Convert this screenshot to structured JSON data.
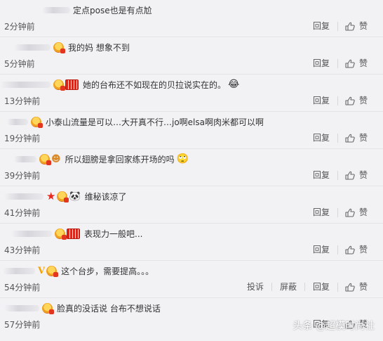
{
  "comments": [
    {
      "indent": 60,
      "blurWidth": 40,
      "badges": [],
      "text": "定点pose也是有点尬",
      "emoji": "",
      "time": "2分钟前",
      "actions": [
        "回复"
      ],
      "like": "赞"
    },
    {
      "indent": 20,
      "blurWidth": 52,
      "badges": [
        "badge"
      ],
      "text": "我的妈 想象不到",
      "emoji": "",
      "time": "5分钟前",
      "actions": [
        "回复"
      ],
      "like": "赞"
    },
    {
      "indent": 0,
      "blurWidth": 72,
      "badges": [
        "badge",
        "red"
      ],
      "text": "她的台布还不如现在的贝拉说实在的。",
      "emoji": "😂",
      "time": "13分钟前",
      "actions": [
        "回复"
      ],
      "like": "赞"
    },
    {
      "indent": 10,
      "blurWidth": 30,
      "badges": [
        "badge"
      ],
      "text": "小泰山流量是可以…大开真不行…jo啊elsa啊肉米都可以啊",
      "emoji": "",
      "time": "19分钟前",
      "actions": [
        "回复"
      ],
      "like": "赞"
    },
    {
      "indent": 20,
      "blurWidth": 32,
      "badges": [
        "badge",
        "cloud"
      ],
      "text": "所以翅膀是拿回家练开场的吗",
      "emoji": "🙄",
      "time": "39分钟前",
      "actions": [
        "回复"
      ],
      "like": "赞"
    },
    {
      "indent": 6,
      "blurWidth": 56,
      "badges": [
        "star",
        "badge",
        "panda"
      ],
      "text": "维秘该凉了",
      "emoji": "",
      "time": "41分钟前",
      "actions": [
        "回复"
      ],
      "like": "赞"
    },
    {
      "indent": 16,
      "blurWidth": 58,
      "badges": [
        "badge",
        "red"
      ],
      "text": "表现力一般吧...",
      "emoji": "",
      "time": "43分钟前",
      "actions": [
        "回复"
      ],
      "like": "赞"
    },
    {
      "indent": 4,
      "blurWidth": 46,
      "badges": [
        "vip",
        "badge"
      ],
      "text": "这个台步，需要提高。。。",
      "emoji": "",
      "time": "54分钟前",
      "actions": [
        "投诉",
        "屏蔽",
        "回复"
      ],
      "like": "赞"
    },
    {
      "indent": 6,
      "blurWidth": 50,
      "badges": [
        "badge"
      ],
      "text": "脸真的没话说 台布不想说话",
      "emoji": "",
      "time": "57分钟前",
      "actions": [
        "回复"
      ],
      "like": "赞"
    }
  ],
  "watermark": "头条 @超模时尚社",
  "colors": {
    "background": "#f2f2f5",
    "divider": "#e3e3e8",
    "text": "#333333",
    "meta": "#555555"
  }
}
